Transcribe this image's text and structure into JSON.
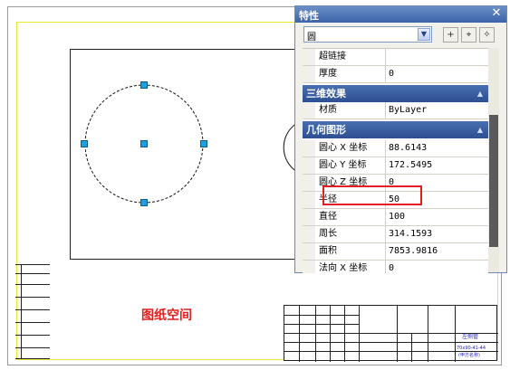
{
  "palette": {
    "title": "特性",
    "close_icon": "close-icon",
    "object_type": "圆",
    "properties": {
      "hyperlink": "超链接",
      "hyperlink_value": "",
      "thickness": "厚度",
      "thickness_value": "0",
      "cat_3d": "三维效果",
      "material": "材质",
      "material_value": "ByLayer",
      "cat_geometry": "几何图形",
      "center_x": "圆心 X 坐标",
      "center_x_value": "88.6143",
      "center_y": "圆心 Y 坐标",
      "center_y_value": "172.5495",
      "center_z": "圆心 Z 坐标",
      "center_z_value": "0",
      "radius": "半径",
      "radius_value": "50",
      "diameter": "直径",
      "diameter_value": "100",
      "circumference": "周长",
      "circumference_value": "314.1593",
      "area": "面积",
      "area_value": "7853.9816",
      "normal_x": "法向 X 坐标",
      "normal_x_value": "0"
    },
    "highlight_color": "#e02020"
  },
  "drawing": {
    "paper_space_label": "图纸空间",
    "title_block_name": "左侧管",
    "title_block_code": "70x90-41-44",
    "title_block_sub": "(甲方名称)",
    "label_color": "#e0201c"
  }
}
